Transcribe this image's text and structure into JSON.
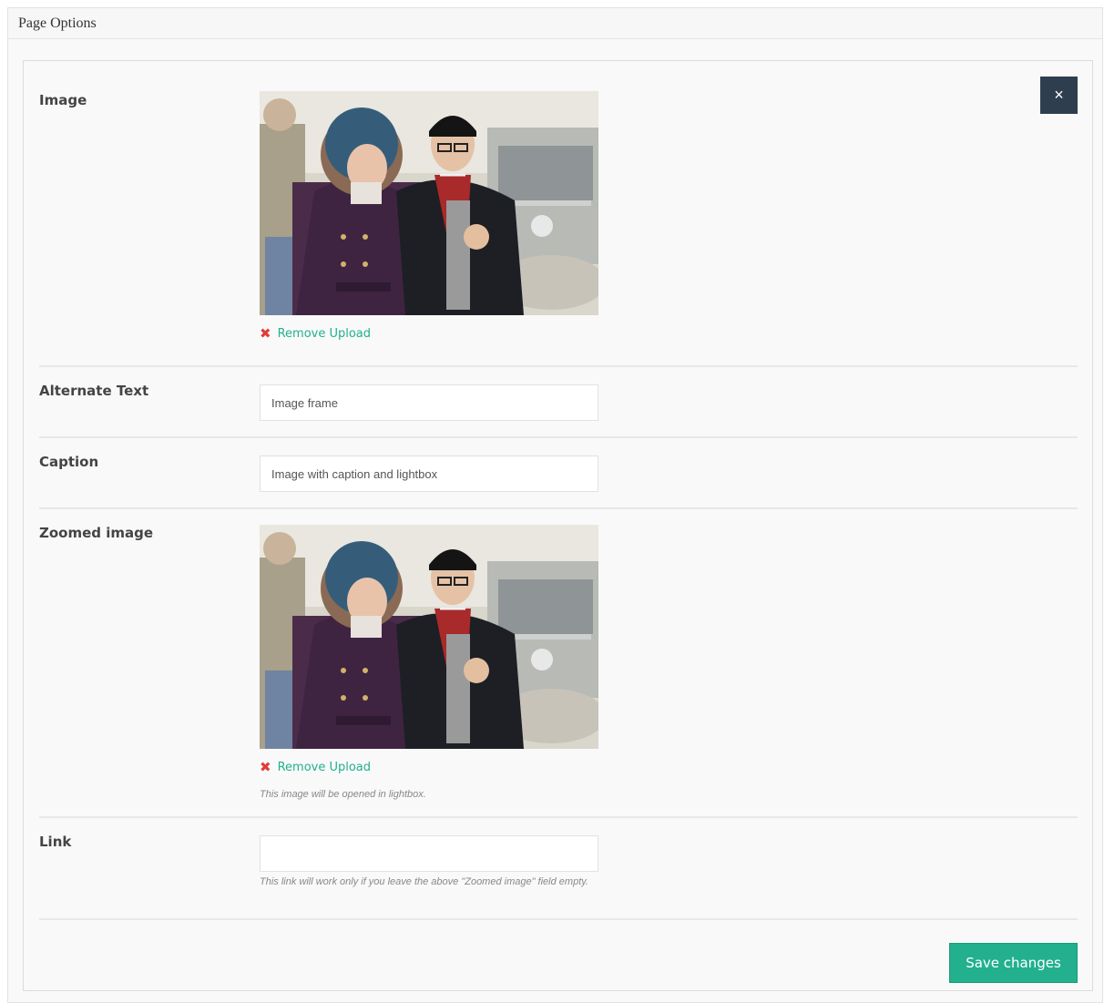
{
  "metabox": {
    "title": "Page Options"
  },
  "panel": {
    "close_label": "×",
    "image": {
      "label": "Image",
      "remove_label": "Remove Upload"
    },
    "alt_text": {
      "label": "Alternate Text",
      "value": "Image frame"
    },
    "caption": {
      "label": "Caption",
      "value": "Image with caption and lightbox"
    },
    "zoomed_image": {
      "label": "Zoomed image",
      "remove_label": "Remove Upload",
      "help": "This image will be opened in lightbox."
    },
    "link": {
      "label": "Link",
      "value": "",
      "help": "This link will work only if you leave the above \"Zoomed image\" field empty."
    },
    "save_label": "Save changes"
  },
  "colors": {
    "accent": "#22b08e",
    "close_button": "#2e3e4f",
    "remove_icon": "#e03c3c"
  },
  "icons": {
    "close": "close-icon",
    "remove": "remove-x-icon"
  }
}
